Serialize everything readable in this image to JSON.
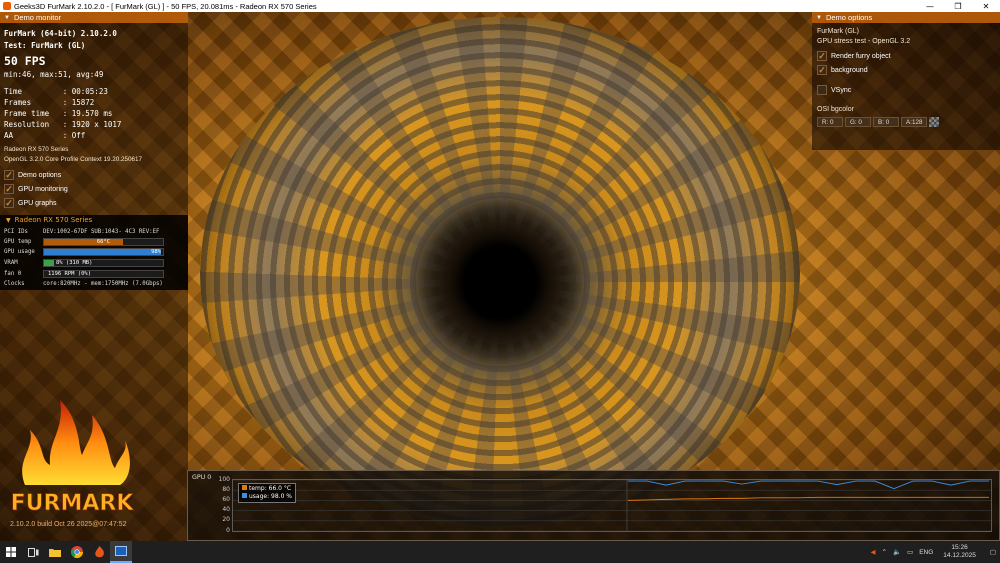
{
  "window": {
    "title": "Geeks3D FurMark 2.10.2.0 - [ FurMark (GL) ] - 50 FPS, 20.081ms - Radeon RX 570 Series",
    "minimize": "—",
    "maximize": "❐",
    "close": "✕"
  },
  "demo_monitor": {
    "header": "Demo monitor",
    "app": "FurMark (64-bit) 2.10.2.0",
    "test": "Test: FurMark (GL)",
    "fps": "50 FPS",
    "fps_stats": "min:46, max:51, avg:49",
    "time": "Time         : 00:05:23",
    "frames": "Frames       : 15872",
    "frame_time": "Frame time   : 19.570 ms",
    "resolution": "Resolution   : 1920 x 1017",
    "aa": "AA           : Off",
    "gpu_name": "Radeon RX 570 Series",
    "opengl": "OpenGL 3.2.0 Core Profile Context 19.20.250617",
    "options": [
      {
        "label": "Demo options",
        "checked": true
      },
      {
        "label": "GPU monitoring",
        "checked": true
      },
      {
        "label": "GPU graphs",
        "checked": true
      }
    ]
  },
  "gpu_monitor": {
    "header": "Radeon RX 570 Series",
    "pci_label": "PCI IDs",
    "pci_value": "DEV:1002-67DF SUB:1043- 4C3 REV:EF",
    "gpu_temp_label": "GPU temp",
    "gpu_temp_value": "66°C",
    "gpu_temp_level": 0.66,
    "gpu_usage_label": "GPU usage",
    "gpu_usage_value": "98%",
    "gpu_usage_level": 0.98,
    "vram_label": "VRAM",
    "vram_value": "8% (310 MB)",
    "vram_level": 0.08,
    "fan_label": "fan 0",
    "fan_value": "1196 RPM (0%)",
    "fan_level": 0.0,
    "clocks_label": "Clocks",
    "clocks_value": "core:820MHz - mem:1750MHz (7.0Gbps)",
    "colors": {
      "temp": "#b05c0c",
      "usage": "#2f7fd1",
      "vram": "#3aa04a"
    }
  },
  "logo": {
    "text": "FURMARK"
  },
  "build": "2.10.2.0 build Oct 26 2025@07:47:52",
  "demo_options": {
    "header": "Demo options",
    "test": "FurMark (GL)",
    "subtitle": "GPU stress test - OpenGL 3.2",
    "render_furry": {
      "label": "Render furry object",
      "checked": true
    },
    "background": {
      "label": "background",
      "checked": true
    },
    "vsync": {
      "label": "VSync",
      "checked": false
    },
    "osi_label": "OSI bgcolor",
    "r": "R: 0",
    "g": "G: 0",
    "b": "B: 0",
    "a": "A:128"
  },
  "graph": {
    "title": "GPU 0",
    "yticks": [
      "100",
      "80",
      "60",
      "40",
      "20",
      "0"
    ],
    "legend_temp": "temp: 66.0 °C",
    "legend_usage": "usage: 98.0 %",
    "colors": {
      "temp": "#e07a10",
      "usage": "#3a8ee6"
    }
  },
  "chart_data": {
    "type": "line",
    "title": "GPU 0",
    "ylim": [
      0,
      100
    ],
    "series": [
      {
        "name": "temp",
        "values": [
          60,
          61,
          62,
          63,
          63,
          64,
          64,
          65,
          65,
          65,
          66,
          66,
          66,
          66,
          66,
          66,
          66,
          66,
          66,
          66
        ]
      },
      {
        "name": "usage",
        "values": [
          98,
          98,
          90,
          98,
          98,
          98,
          92,
          98,
          98,
          98,
          98,
          91,
          98,
          98,
          83,
          98,
          98,
          90,
          98,
          98
        ]
      }
    ]
  },
  "taskbar": {
    "lang": "ENG",
    "time": "15:26",
    "date": "14.12.2025"
  }
}
